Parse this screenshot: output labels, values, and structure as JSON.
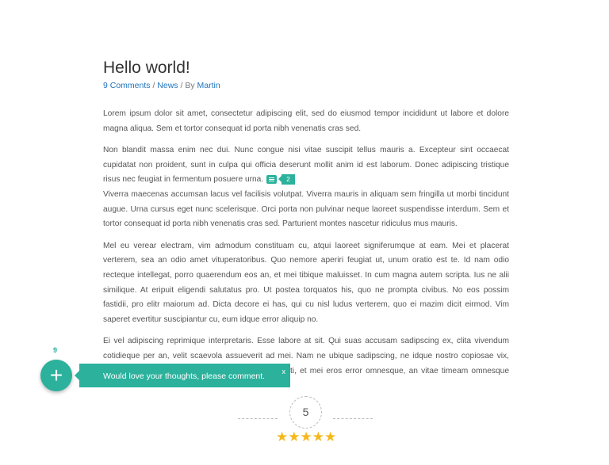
{
  "article": {
    "title": "Hello world!",
    "meta": {
      "comments_link": "9 Comments",
      "sep1": " / ",
      "category_link": "News",
      "sep2": " / By ",
      "author_link": "Martin"
    },
    "paragraphs": [
      "Lorem ipsum dolor sit amet, consectetur adipiscing elit, sed do eiusmod tempor incididunt ut labore et dolore magna aliqua.  Sem et tortor consequat id porta nibh venenatis cras sed.",
      "Non blandit massa enim nec dui. Nunc congue nisi vitae suscipit tellus mauris a. Excepteur sint occaecat cupidatat non proident, sunt in culpa qui officia deserunt mollit anim id est laborum. Donec adipiscing tristique risus nec feugiat in fermentum posuere urna.",
      "Viverra maecenas accumsan lacus vel facilisis volutpat. Viverra mauris in aliquam sem fringilla ut morbi tincidunt augue. Urna cursus eget nunc scelerisque. Orci porta non pulvinar neque laoreet suspendisse interdum. Sem et tortor consequat id porta nibh venenatis cras sed. Parturient montes nascetur ridiculus mus mauris.",
      "Mel eu verear electram, vim admodum constituam cu, atqui laoreet signiferumque at eam. Mei et placerat verterem, sea an odio amet vituperatoribus. Quo nemore aperiri feugiat ut, unum oratio est te. Id nam odio recteque intellegat, porro quaerendum eos an, et mei tibique maluisset. In cum magna autem scripta. Ius ne alii similique. At eripuit eligendi salutatus pro. Ut postea torquatos his, quo ne prompta civibus. No eos possim fastidii, pro elitr maiorum ad. Dicta decore ei has, qui cu nisl ludus verterem, quo ei mazim dicit eirmod. Vim saperet evertitur suscipiantur cu, eum idque error aliquip no.",
      "Ei vel adipiscing reprimique interpretaris. Esse labore at sit. Qui suas accusam sadipscing ex, clita vivendum cotidieque per an, velit scaevola assueverit ad mei. Nam ne ubique sadipscing, ne idque nostro copiosae vix, populo delenitus vis. Eam ut nisi habemus nominati, et mei eros error omnesque, an vitae timeam omnesque nam."
    ],
    "inline_comment_count": "2"
  },
  "comment_widget": {
    "count": "9",
    "fab_icon": "plus-icon",
    "toast_text": "Would love your thoughts, please comment.",
    "close_label": "x",
    "accent_color": "#2bb19c"
  },
  "rating": {
    "score": "5",
    "stars": "★★★★★",
    "star_color": "#f5b81c"
  }
}
